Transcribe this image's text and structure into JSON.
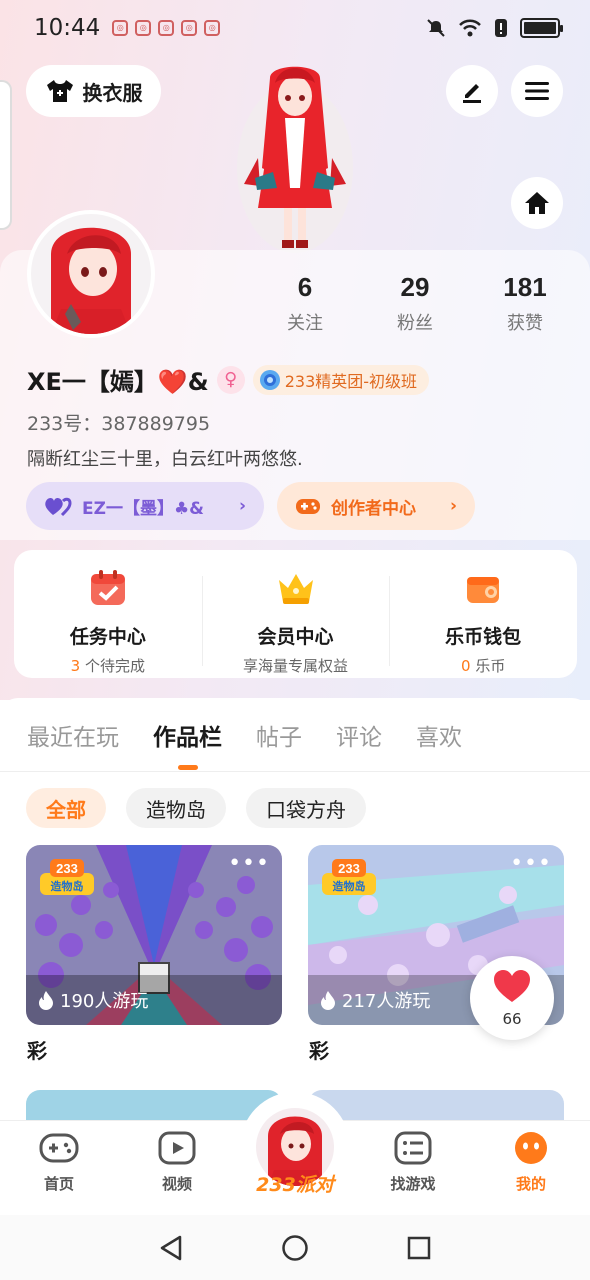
{
  "status_bar": {
    "time": "10:44"
  },
  "header": {
    "outfit_label": "换衣服"
  },
  "stats": [
    {
      "value": "6",
      "label": "关注"
    },
    {
      "value": "29",
      "label": "粉丝"
    },
    {
      "value": "181",
      "label": "获赞"
    }
  ],
  "profile": {
    "name": "XE一【嫣】❤️&",
    "gender_symbol": "♀",
    "badge": "233精英团-初级班",
    "uid_label": "233号：",
    "uid": "387889795",
    "bio": "隔断红尘三十里，白云红叶两悠悠."
  },
  "tag_buttons": {
    "family": "EZ一【墨】♣&",
    "creator": "创作者中心"
  },
  "quick_links": [
    {
      "title": "任务中心",
      "count": "3",
      "suffix": " 个待完成"
    },
    {
      "title": "会员中心",
      "subtitle": "享海量专属权益"
    },
    {
      "title": "乐币钱包",
      "count": "0",
      "suffix": " 乐币"
    }
  ],
  "tabs": [
    "最近在玩",
    "作品栏",
    "帖子",
    "评论",
    "喜欢"
  ],
  "active_tab": "作品栏",
  "filters": [
    "全部",
    "造物岛",
    "口袋方舟"
  ],
  "games": [
    {
      "plays": "190人游玩",
      "title": "彩"
    },
    {
      "plays": "217人游玩",
      "title": "彩"
    }
  ],
  "game_logo_text": "233造物岛",
  "like_count": "66",
  "bottom_nav": [
    "首页",
    "视频",
    "找游戏",
    "我的"
  ],
  "party_label": "233派对",
  "colors": {
    "accent": "#ff7a1a",
    "heart": "#f0384a",
    "family_chip": "#e6def8",
    "creator_chip": "#ffe8d8"
  }
}
